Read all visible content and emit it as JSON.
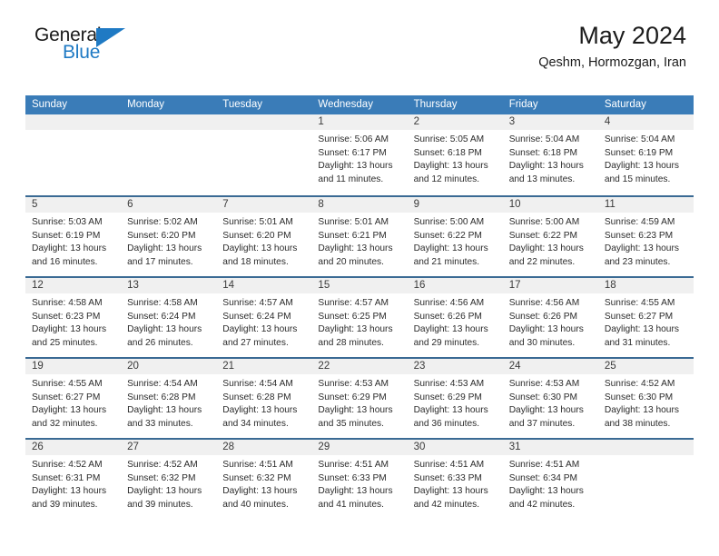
{
  "brand": {
    "name_dark": "General",
    "name_blue": "Blue",
    "accent_color": "#1f7ac4"
  },
  "header": {
    "title": "May 2024",
    "subtitle": "Qeshm, Hormozgan, Iran",
    "header_bg_color": "#3a7cb8",
    "divider_color": "#3a6a94",
    "day_strip_color": "#f0f0f0"
  },
  "weekdays": [
    "Sunday",
    "Monday",
    "Tuesday",
    "Wednesday",
    "Thursday",
    "Friday",
    "Saturday"
  ],
  "weeks": [
    [
      {
        "day": "",
        "empty": true,
        "lines": []
      },
      {
        "day": "",
        "empty": true,
        "lines": []
      },
      {
        "day": "",
        "empty": true,
        "lines": []
      },
      {
        "day": "1",
        "empty": false,
        "lines": [
          "Sunrise: 5:06 AM",
          "Sunset: 6:17 PM",
          "Daylight: 13 hours",
          "and 11 minutes."
        ]
      },
      {
        "day": "2",
        "empty": false,
        "lines": [
          "Sunrise: 5:05 AM",
          "Sunset: 6:18 PM",
          "Daylight: 13 hours",
          "and 12 minutes."
        ]
      },
      {
        "day": "3",
        "empty": false,
        "lines": [
          "Sunrise: 5:04 AM",
          "Sunset: 6:18 PM",
          "Daylight: 13 hours",
          "and 13 minutes."
        ]
      },
      {
        "day": "4",
        "empty": false,
        "lines": [
          "Sunrise: 5:04 AM",
          "Sunset: 6:19 PM",
          "Daylight: 13 hours",
          "and 15 minutes."
        ]
      }
    ],
    [
      {
        "day": "5",
        "empty": false,
        "lines": [
          "Sunrise: 5:03 AM",
          "Sunset: 6:19 PM",
          "Daylight: 13 hours",
          "and 16 minutes."
        ]
      },
      {
        "day": "6",
        "empty": false,
        "lines": [
          "Sunrise: 5:02 AM",
          "Sunset: 6:20 PM",
          "Daylight: 13 hours",
          "and 17 minutes."
        ]
      },
      {
        "day": "7",
        "empty": false,
        "lines": [
          "Sunrise: 5:01 AM",
          "Sunset: 6:20 PM",
          "Daylight: 13 hours",
          "and 18 minutes."
        ]
      },
      {
        "day": "8",
        "empty": false,
        "lines": [
          "Sunrise: 5:01 AM",
          "Sunset: 6:21 PM",
          "Daylight: 13 hours",
          "and 20 minutes."
        ]
      },
      {
        "day": "9",
        "empty": false,
        "lines": [
          "Sunrise: 5:00 AM",
          "Sunset: 6:22 PM",
          "Daylight: 13 hours",
          "and 21 minutes."
        ]
      },
      {
        "day": "10",
        "empty": false,
        "lines": [
          "Sunrise: 5:00 AM",
          "Sunset: 6:22 PM",
          "Daylight: 13 hours",
          "and 22 minutes."
        ]
      },
      {
        "day": "11",
        "empty": false,
        "lines": [
          "Sunrise: 4:59 AM",
          "Sunset: 6:23 PM",
          "Daylight: 13 hours",
          "and 23 minutes."
        ]
      }
    ],
    [
      {
        "day": "12",
        "empty": false,
        "lines": [
          "Sunrise: 4:58 AM",
          "Sunset: 6:23 PM",
          "Daylight: 13 hours",
          "and 25 minutes."
        ]
      },
      {
        "day": "13",
        "empty": false,
        "lines": [
          "Sunrise: 4:58 AM",
          "Sunset: 6:24 PM",
          "Daylight: 13 hours",
          "and 26 minutes."
        ]
      },
      {
        "day": "14",
        "empty": false,
        "lines": [
          "Sunrise: 4:57 AM",
          "Sunset: 6:24 PM",
          "Daylight: 13 hours",
          "and 27 minutes."
        ]
      },
      {
        "day": "15",
        "empty": false,
        "lines": [
          "Sunrise: 4:57 AM",
          "Sunset: 6:25 PM",
          "Daylight: 13 hours",
          "and 28 minutes."
        ]
      },
      {
        "day": "16",
        "empty": false,
        "lines": [
          "Sunrise: 4:56 AM",
          "Sunset: 6:26 PM",
          "Daylight: 13 hours",
          "and 29 minutes."
        ]
      },
      {
        "day": "17",
        "empty": false,
        "lines": [
          "Sunrise: 4:56 AM",
          "Sunset: 6:26 PM",
          "Daylight: 13 hours",
          "and 30 minutes."
        ]
      },
      {
        "day": "18",
        "empty": false,
        "lines": [
          "Sunrise: 4:55 AM",
          "Sunset: 6:27 PM",
          "Daylight: 13 hours",
          "and 31 minutes."
        ]
      }
    ],
    [
      {
        "day": "19",
        "empty": false,
        "lines": [
          "Sunrise: 4:55 AM",
          "Sunset: 6:27 PM",
          "Daylight: 13 hours",
          "and 32 minutes."
        ]
      },
      {
        "day": "20",
        "empty": false,
        "lines": [
          "Sunrise: 4:54 AM",
          "Sunset: 6:28 PM",
          "Daylight: 13 hours",
          "and 33 minutes."
        ]
      },
      {
        "day": "21",
        "empty": false,
        "lines": [
          "Sunrise: 4:54 AM",
          "Sunset: 6:28 PM",
          "Daylight: 13 hours",
          "and 34 minutes."
        ]
      },
      {
        "day": "22",
        "empty": false,
        "lines": [
          "Sunrise: 4:53 AM",
          "Sunset: 6:29 PM",
          "Daylight: 13 hours",
          "and 35 minutes."
        ]
      },
      {
        "day": "23",
        "empty": false,
        "lines": [
          "Sunrise: 4:53 AM",
          "Sunset: 6:29 PM",
          "Daylight: 13 hours",
          "and 36 minutes."
        ]
      },
      {
        "day": "24",
        "empty": false,
        "lines": [
          "Sunrise: 4:53 AM",
          "Sunset: 6:30 PM",
          "Daylight: 13 hours",
          "and 37 minutes."
        ]
      },
      {
        "day": "25",
        "empty": false,
        "lines": [
          "Sunrise: 4:52 AM",
          "Sunset: 6:30 PM",
          "Daylight: 13 hours",
          "and 38 minutes."
        ]
      }
    ],
    [
      {
        "day": "26",
        "empty": false,
        "lines": [
          "Sunrise: 4:52 AM",
          "Sunset: 6:31 PM",
          "Daylight: 13 hours",
          "and 39 minutes."
        ]
      },
      {
        "day": "27",
        "empty": false,
        "lines": [
          "Sunrise: 4:52 AM",
          "Sunset: 6:32 PM",
          "Daylight: 13 hours",
          "and 39 minutes."
        ]
      },
      {
        "day": "28",
        "empty": false,
        "lines": [
          "Sunrise: 4:51 AM",
          "Sunset: 6:32 PM",
          "Daylight: 13 hours",
          "and 40 minutes."
        ]
      },
      {
        "day": "29",
        "empty": false,
        "lines": [
          "Sunrise: 4:51 AM",
          "Sunset: 6:33 PM",
          "Daylight: 13 hours",
          "and 41 minutes."
        ]
      },
      {
        "day": "30",
        "empty": false,
        "lines": [
          "Sunrise: 4:51 AM",
          "Sunset: 6:33 PM",
          "Daylight: 13 hours",
          "and 42 minutes."
        ]
      },
      {
        "day": "31",
        "empty": false,
        "lines": [
          "Sunrise: 4:51 AM",
          "Sunset: 6:34 PM",
          "Daylight: 13 hours",
          "and 42 minutes."
        ]
      },
      {
        "day": "",
        "empty": true,
        "lines": []
      }
    ]
  ]
}
